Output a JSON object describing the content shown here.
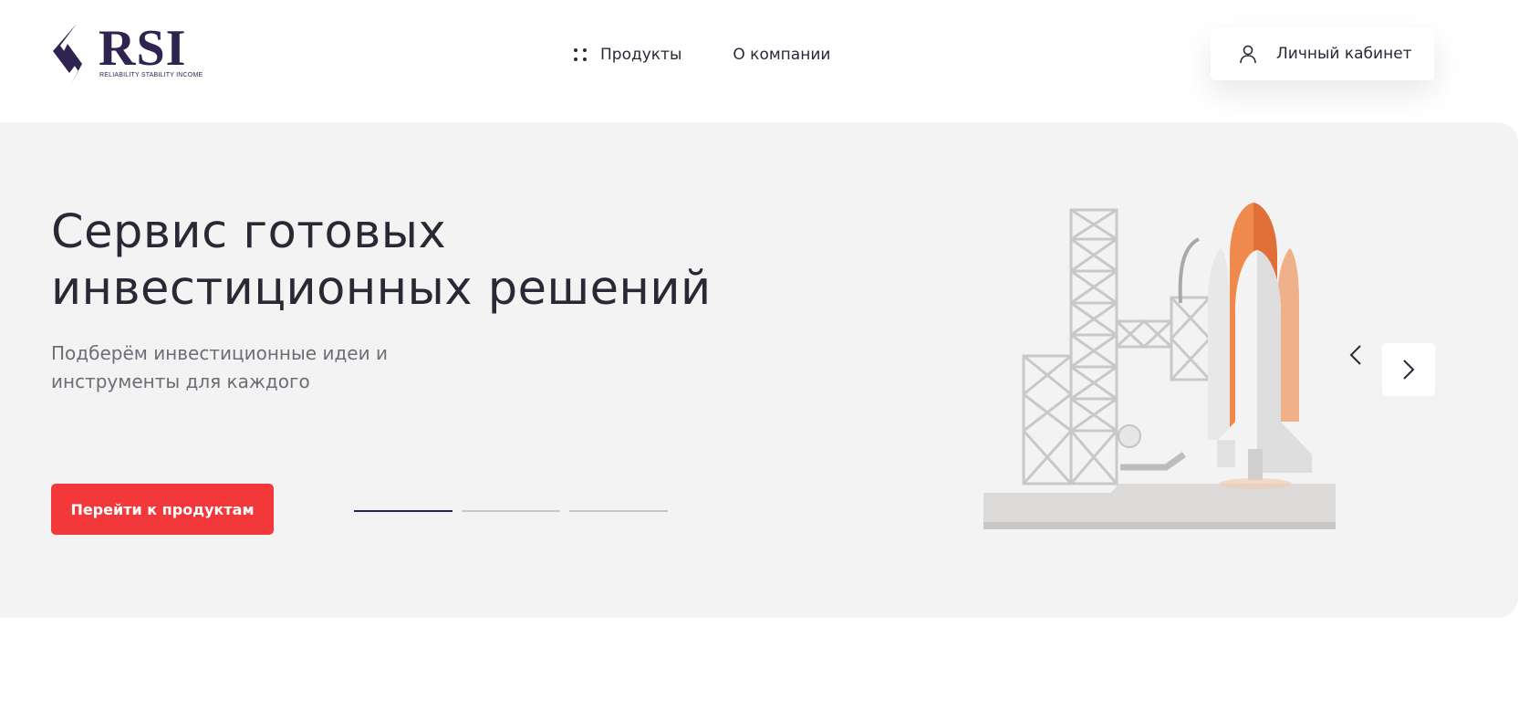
{
  "header": {
    "logo": {
      "text": "RSI",
      "tagline": "RELIABILITY STABILITY INCOME",
      "color": "#2f2350"
    },
    "nav": [
      {
        "label": "Продукты",
        "icon": "grid-dots-icon"
      },
      {
        "label": "О компании"
      }
    ],
    "account": {
      "label": "Личный кабинет",
      "icon": "user-icon"
    }
  },
  "hero": {
    "title_line1": "Сервис готовых",
    "title_line2": "инвестиционных решений",
    "subtitle_line1": "Подберём инвестиционные идеи и",
    "subtitle_line2": "инструменты для каждого",
    "cta_label": "Перейти к продуктам",
    "cta_color": "#f2383a",
    "slider": {
      "slide_count": 3,
      "active_slide": 1,
      "prev_icon": "chevron-left-icon",
      "next_icon": "chevron-right-icon"
    },
    "illustration": "rocket-launch-pad-illustration",
    "background": "#f3f3f3"
  }
}
